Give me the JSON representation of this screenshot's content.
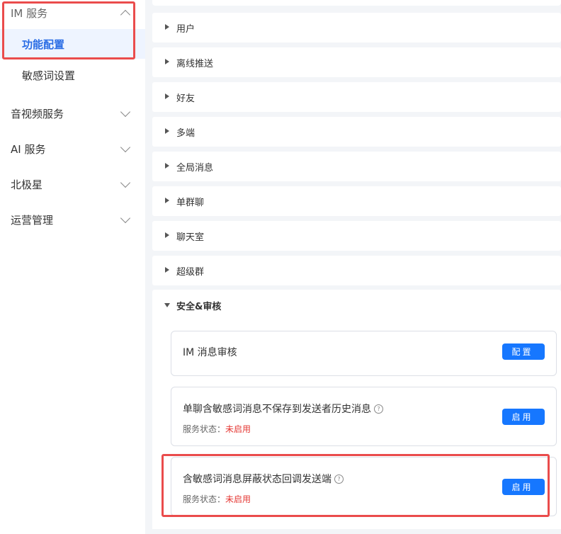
{
  "sidebar": {
    "im_service": "IM 服务",
    "sub_items": [
      {
        "label": "功能配置",
        "active": true
      },
      {
        "label": "敏感词设置",
        "active": false
      }
    ],
    "groups": [
      {
        "label": "音视频服务"
      },
      {
        "label": "AI 服务"
      },
      {
        "label": "北极星"
      },
      {
        "label": "运营管理"
      }
    ]
  },
  "main": {
    "rows": [
      {
        "label": "用户"
      },
      {
        "label": "离线推送"
      },
      {
        "label": "好友"
      },
      {
        "label": "多端"
      },
      {
        "label": "全局消息"
      },
      {
        "label": "单群聊"
      },
      {
        "label": "聊天室"
      },
      {
        "label": "超级群"
      }
    ],
    "expanded": {
      "label": "安全&审核",
      "cards": [
        {
          "title": "IM 消息审核",
          "button": "配置"
        },
        {
          "title": "单聊含敏感词消息不保存到发送者历史消息",
          "status_label": "服务状态：",
          "status_value": "未启用",
          "button": "启用"
        },
        {
          "title": "含敏感词消息屏蔽状态回调发送端",
          "status_label": "服务状态：",
          "status_value": "未启用",
          "button": "启用"
        }
      ]
    }
  },
  "colors": {
    "accent": "#1677ff",
    "highlight_box": "#ea4c4c",
    "status_off": "#e53935",
    "active_text": "#2b6de5"
  }
}
